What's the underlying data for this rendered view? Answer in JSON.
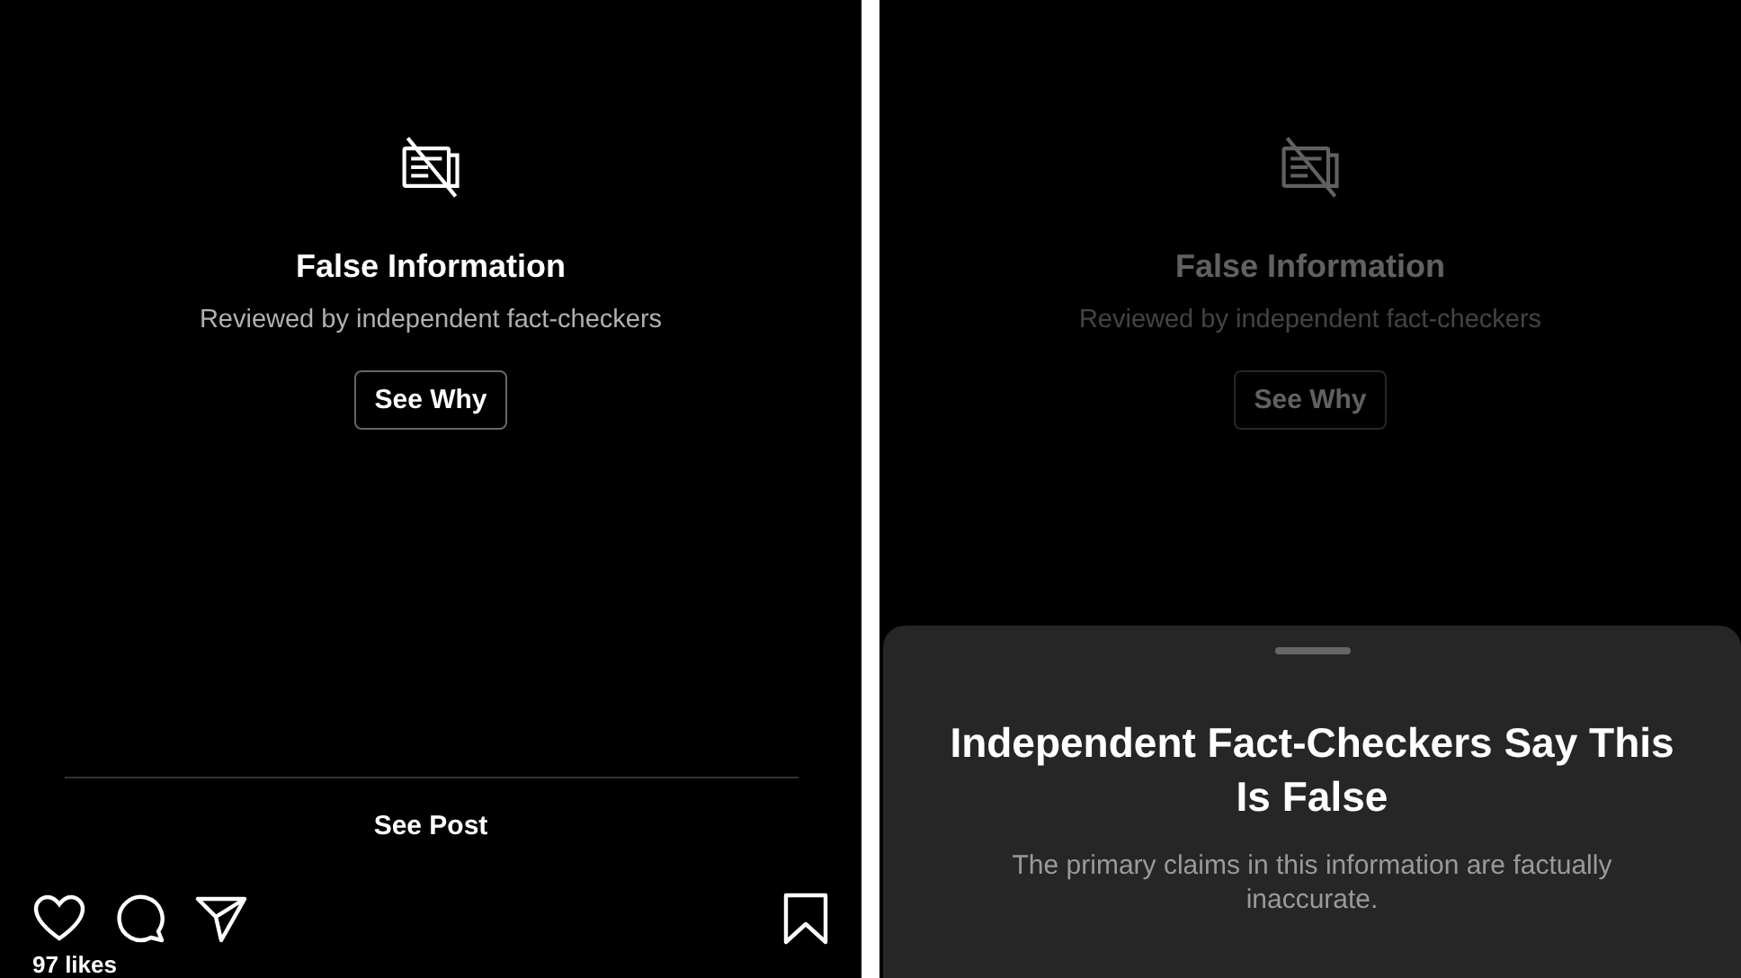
{
  "screens": [
    {
      "dimmed": false,
      "notice": {
        "title": "False Information",
        "subtitle": "Reviewed by independent fact-checkers",
        "button": "See Why"
      },
      "see_post": "See Post",
      "likes": "97 likes"
    },
    {
      "dimmed": true,
      "notice": {
        "title": "False Information",
        "subtitle": "Reviewed by independent fact-checkers",
        "button": "See Why"
      },
      "sheet": {
        "title": "Independent Fact-Checkers Say This Is False",
        "body": "The primary claims in this information are factually inaccurate."
      }
    }
  ]
}
